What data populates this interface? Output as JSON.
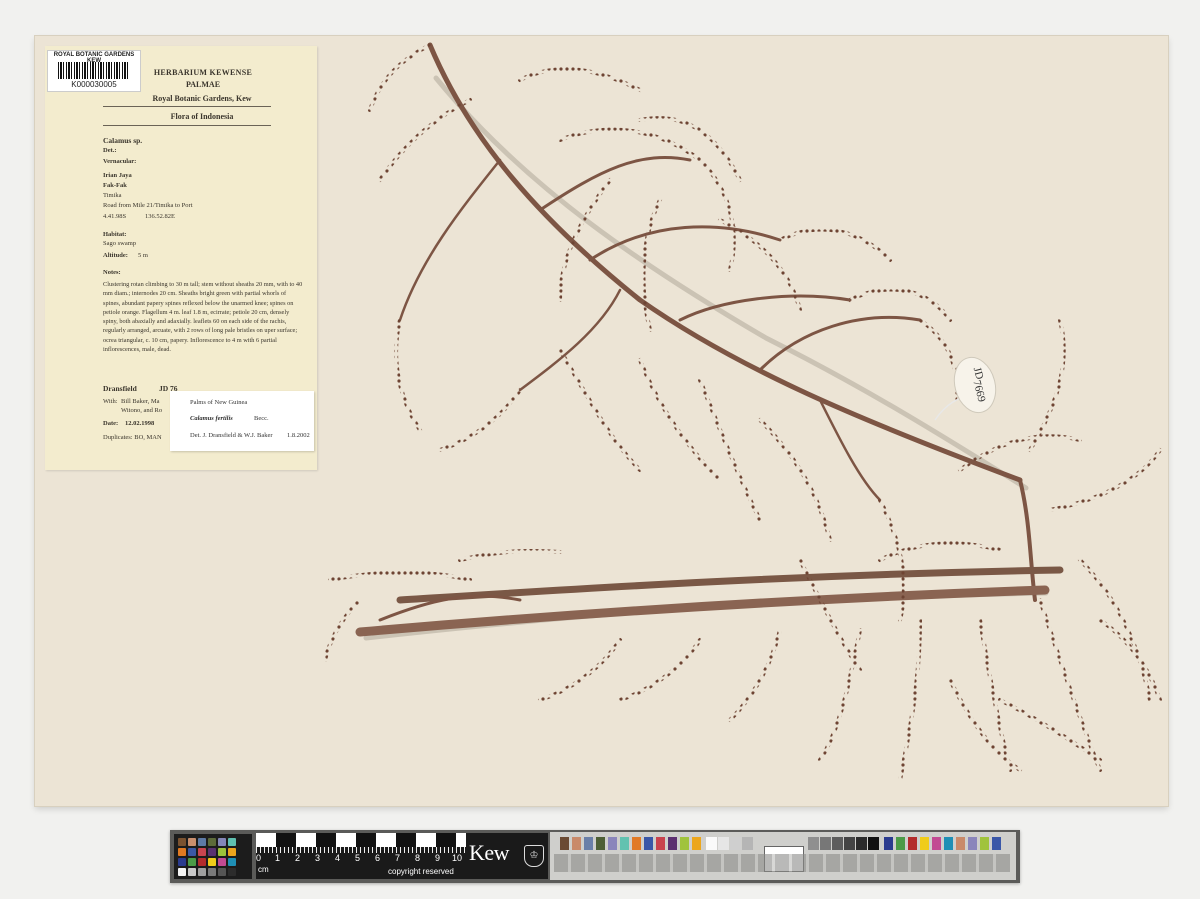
{
  "label": {
    "barcode_title": "ROYAL BOTANIC GARDENS KEW",
    "barcode_number": "K000030005",
    "herbarium": "HERBARIUM KEWENSE",
    "family": "PALMAE",
    "institution": "Royal Botanic Gardens, Kew",
    "flora": "Flora of Indonesia",
    "taxon": "Calamus sp.",
    "det": "Det.:",
    "vernacular": "Vernacular:",
    "region": "Irian Jaya",
    "district": "Fak-Fak",
    "place": "Timika",
    "road": "Road from Mile 21/Timika to Port",
    "lat": "4.41.98S",
    "lon": "136.52.82E",
    "habitat_label": "Habitat:",
    "habitat": "Sago swamp",
    "altitude_label": "Altitude:",
    "altitude": "5 m",
    "notes_label": "Notes:",
    "notes": "Clustering rotan climbing to 30 m tall; stem without sheaths 20 mm, with to 40 mm diam.; internodes 20 cm. Sheaths bright green with partial whorls of spines, abundant papery spines reflexed below the unarmed knee; spines on petiole orange. Flagellum 4 m. leaf 1.8 m, ecirrate; petiole 20 cm, densely spiny, both abaxially and adaxially. leaflets 60 on each side of the rachis, regularly arranged, arcuate, with 2 rows of long pale bristles on uper surface; ocrea triangular, c. 10 cm, papery. Inflorescence to 4 m with 6 partial inflorescences, male, dead.",
    "collector": "Dransfield",
    "collector_no": "JD 76",
    "with_label": "With:",
    "with_line1": "Bill Baker, Ma",
    "with_line2": "Witono, and Ro",
    "date_label": "Date:",
    "date": "12.02.1998",
    "duplicates": "Duplicates: BO, MAN"
  },
  "det_slip": {
    "line1": "Palms of New Guinea",
    "species": "Calamus fertilis",
    "author": "Becc.",
    "det": "Det. J. Dransfield & W.J. Baker",
    "date": "1.8.2002"
  },
  "tag": {
    "line1": "JD",
    "line2": "7669"
  },
  "scale_bar": {
    "numbers": [
      "0",
      "1",
      "2",
      "3",
      "4",
      "5",
      "6",
      "7",
      "8",
      "9",
      "10"
    ],
    "unit": "cm",
    "copyright": "copyright reserved",
    "brand": "Kew",
    "crest": "♔"
  },
  "colors": {
    "sheet": "#ece4d5",
    "label": "#f3ecce",
    "specimen": "#7a4e3a",
    "specimen_dark": "#5a3526"
  }
}
